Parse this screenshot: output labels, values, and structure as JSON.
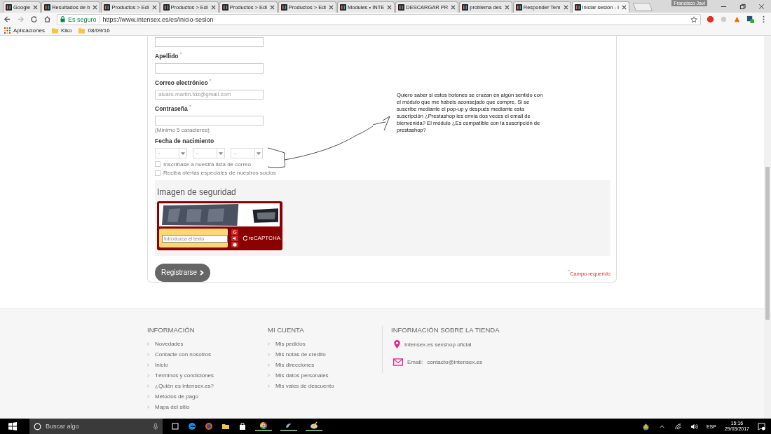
{
  "browser": {
    "tabs": [
      {
        "title": "Google",
        "selected": false
      },
      {
        "title": "Resultados de b",
        "selected": false
      },
      {
        "title": "Productos > Edi",
        "selected": false
      },
      {
        "title": "Productos > Edi",
        "selected": false
      },
      {
        "title": "Productos > Edi",
        "selected": false
      },
      {
        "title": "Productos > Edi",
        "selected": false
      },
      {
        "title": "Modules • INTE",
        "selected": false
      },
      {
        "title": "DESCARGAR PR",
        "selected": false
      },
      {
        "title": "problema des",
        "selected": false
      },
      {
        "title": "Responder Tem",
        "selected": false
      },
      {
        "title": "Iniciar sesión - I",
        "selected": true
      }
    ],
    "profile": "Francisco Javi",
    "security": "Es seguro",
    "url": "https://www.intensex.es/es/inicio-sesion",
    "bookmarks": [
      "Aplicaciones",
      "Kiko",
      "08/09/16"
    ]
  },
  "form": {
    "fields": [
      {
        "kind": "text"
      },
      {
        "kind": "text",
        "label": "Apellido $^{*}$"
      },
      {
        "kind": "text",
        "label": "Correo electrónico $^{*}$",
        "placeholder": "alvaro.martin.fdz@gmail.com"
      },
      {
        "kind": "text",
        "label": "Contraseña $^{*}$",
        "hint": "(Mínimo 5 caracteres)"
      }
    ],
    "birthdate": {
      "label": "Fecha de nacimiento",
      "selects": [
        "-",
        "-",
        "-"
      ]
    },
    "checkboxes": [
      {
        "label": "Inscríbase a nuestra lista de correo",
        "checked": false
      },
      {
        "label": "Reciba ofertas especiales de nuestros socios",
        "checked": false
      }
    ],
    "captcha": {
      "title": "Imagen de seguridad",
      "placeholder": "Introduzca el texto",
      "logo": "reCAPTCHA"
    },
    "submit": "Registrarse",
    "required_note": "$^{*}$Campo requerido"
  },
  "annotation": "Quiero saber si estos botones se cruzan en algún sentido con el módulo que me habeis aconsejado que compre. Si se suscribe mediante el pop-up y después mediante esta suscripción ¿Prestashop les envía dos veces el email de bienvenida? El módulo ¿Es compatible con la suscripción de prestashop?",
  "footer": {
    "columns": [
      {
        "heading": "INFORMACIÓN",
        "links": [
          "Novedades",
          "Contacte con nosotros",
          "Inicio",
          "Términos y condiciones",
          "¿Quién es intensex.es?",
          "Métodos de pago",
          "Mapa del sitio"
        ]
      },
      {
        "heading": "MI CUENTA",
        "links": [
          "Mis pedidos",
          "Mis notas de credito",
          "Mis direcciones",
          "Mis datos personales",
          "Mis vales de descuento"
        ]
      }
    ],
    "store": {
      "heading": "INFORMACIÓN SOBRE LA TIENDA",
      "address": "Intensex.es sexshop oficial",
      "email_label": "Email:",
      "email": "contacto@intensex.es"
    }
  },
  "taskbar": {
    "search_placeholder": "Buscar algo",
    "language": "ESP",
    "time": "15:16",
    "date": "29/03/2017"
  }
}
